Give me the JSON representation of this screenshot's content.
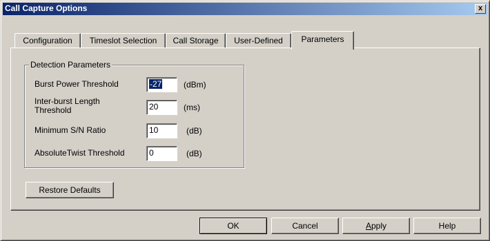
{
  "window": {
    "title": "Call Capture Options",
    "close_glyph": "x"
  },
  "tabs": [
    {
      "label": "Configuration",
      "active": false
    },
    {
      "label": "Timeslot Selection",
      "active": false
    },
    {
      "label": "Call Storage",
      "active": false
    },
    {
      "label": "User-Defined",
      "active": false
    },
    {
      "label": "Parameters",
      "active": true
    }
  ],
  "detection": {
    "group_title": "Detection Parameters",
    "fields": [
      {
        "label_line1": "Burst Power Threshold",
        "label_line2": "",
        "value": "-27",
        "unit": "(dBm)",
        "selected": true
      },
      {
        "label_line1": "Inter-burst Length",
        "label_line2": "Threshold",
        "value": "20",
        "unit": "(ms)",
        "selected": false
      },
      {
        "label_line1": "Minimum S/N Ratio",
        "label_line2": "",
        "value": "10",
        "unit": "(dB)",
        "selected": false
      },
      {
        "label_line1": "AbsoluteTwist Threshold",
        "label_line2": "",
        "value": "0",
        "unit": "(dB)",
        "selected": false
      }
    ]
  },
  "restore_defaults_label": "Restore Defaults",
  "buttons": {
    "ok": "OK",
    "cancel": "Cancel",
    "apply_first": "A",
    "apply_rest": "pply",
    "help": "Help"
  }
}
